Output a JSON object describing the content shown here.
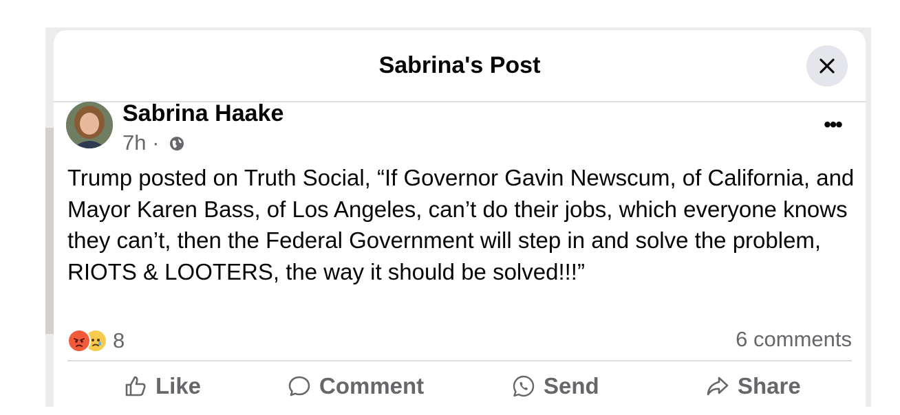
{
  "dialog": {
    "title": "Sabrina's Post",
    "close_icon": "close-icon"
  },
  "post": {
    "author": "Sabrina Haake",
    "time": "7h",
    "separator": "·",
    "audience_icon": "globe-icon",
    "more_icon": "more-options-icon",
    "body": "Trump posted on Truth Social, “If Governor Gavin Newscum, of California, and Mayor Karen Bass, of Los Angeles, can’t do their jobs, which everyone knows they can’t, then the Federal Government will step in and solve the problem, RIOTS & LOOTERS, the way it should be solved!!!”",
    "reactions": {
      "icons": [
        "angry-reaction-icon",
        "sad-reaction-icon"
      ],
      "count": "8"
    },
    "comments": "6 comments"
  },
  "actions": {
    "like": "Like",
    "comment": "Comment",
    "send": "Send",
    "share": "Share"
  },
  "colors": {
    "text_primary": "#050505",
    "text_secondary": "#65676b",
    "divider": "#dadde1",
    "close_bg": "#e4e6eb",
    "angry": "#f25a3c",
    "sad": "#f7c94c"
  }
}
